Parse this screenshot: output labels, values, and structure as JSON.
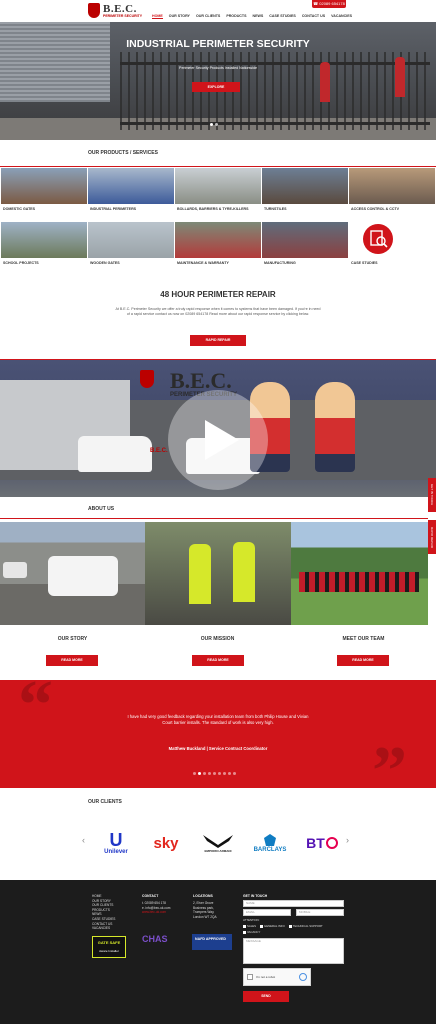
{
  "header": {
    "logo_text": "B.E.C.",
    "logo_sub": "PERIMETER SECURITY",
    "phone": "☎ 02089 654178",
    "nav": [
      "HOME",
      "OUR STORY",
      "OUR CLIENTS",
      "PRODUCTS",
      "NEWS",
      "CASE STUDIES",
      "CONTACT US",
      "VACANCIES"
    ]
  },
  "hero": {
    "title": "INDUSTRIAL PERIMETER SECURITY",
    "subtitle": "Perimeter Security Products Installed Nationwide",
    "button": "EXPLORE"
  },
  "products": {
    "title": "OUR PRODUCTS / SERVICES",
    "items": [
      "DOMESTIC GATES",
      "INDUSTRIAL PERIMETERS",
      "BOLLARDS, BARRIERS & TYRE-KILLERS",
      "TURNSTILES",
      "ACCESS CONTROL & CCTV",
      "SCHOOL PROJECTS",
      "WOODEN GATES",
      "MAINTENANCE & WARRANTY",
      "MANUFACTURING",
      "CASE STUDIES"
    ]
  },
  "repair": {
    "title": "48 HOUR PERIMETER REPAIR",
    "text": "At B.E.C. Perimeter Security we offer a truly rapid response when it comes to systems that have been damaged. If you're in need of a rapid service contact us now on 02089 654178 Read more about our rapid response service by clicking below.",
    "button": "RAPID REPAIR"
  },
  "video": {
    "logo_text": "B.E.C.",
    "logo_sub": "PERIMETER SECURITY",
    "van_text": "B.E.C."
  },
  "side_tabs": [
    "GET IN TOUCH",
    "RAPID REPAIR"
  ],
  "about": {
    "title": "ABOUT US",
    "columns": [
      {
        "title": "OUR STORY",
        "button": "READ MORE"
      },
      {
        "title": "OUR MISSION",
        "button": "READ MORE"
      },
      {
        "title": "MEET OUR TEAM",
        "button": "READ MORE"
      }
    ]
  },
  "testimonial": {
    "text": "I have had very good feedback regarding your installation team from both Philip House and Vivian Court barrier installs. The standard of work is also very high.",
    "name": "Matthew Buckland | Service Contract Coordinator"
  },
  "clients": {
    "title": "OUR CLIENTS",
    "logos": [
      "Unilever",
      "sky",
      "EMPORIO ARMANI",
      "BARCLAYS",
      "BT"
    ]
  },
  "footer": {
    "links": [
      "HOME",
      "OUR STORY",
      "OUR CLIENTS",
      "PRODUCTS",
      "NEWS",
      "CASE STUDIES",
      "CONTACT US",
      "VACANCIES"
    ],
    "contact_title": "CONTACT",
    "contact_phone": "t. 02089 654 178",
    "contact_email": "e. info@bec-uk.com",
    "contact_web": "www.bec-uk.com",
    "locations_title": "LOCATIONS",
    "address": [
      "2, Elver Grove",
      "Business park,",
      "Trumpers Way,",
      "London W7 2QA"
    ],
    "form_title": "GET IN TOUCH",
    "name_placeholder": "NAME",
    "email_placeholder": "EMAIL",
    "phone_placeholder": "MOBILE",
    "attention_label": "ATTENTION:",
    "options": [
      "SALES",
      "GENERAL INFO",
      "TECHNICAL SUPPORT",
      "VACANCY"
    ],
    "message_placeholder": "MESSAGE",
    "captcha": "I'm not a robot",
    "send": "SEND",
    "badge_gate": "GATE SAFE",
    "badge_gate_sub": "Aware Installer",
    "badge_chas": "CHAS",
    "badge_nafd": "NAFD APPROVED"
  },
  "colors": {
    "brand_red": "#d0141a",
    "footer_bg": "#1c1c1c"
  }
}
